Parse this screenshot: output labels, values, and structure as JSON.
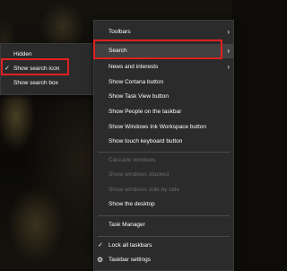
{
  "main_menu": {
    "items": [
      {
        "label": "Toolbars",
        "has_submenu": true,
        "disabled": false
      },
      {
        "label": "Search",
        "has_submenu": true,
        "disabled": false
      },
      {
        "label": "News and interests",
        "has_submenu": true,
        "disabled": false
      },
      {
        "label": "Show Cortana button",
        "disabled": false
      },
      {
        "label": "Show Task View button",
        "disabled": false
      },
      {
        "label": "Show People on the taskbar",
        "disabled": false
      },
      {
        "label": "Show Windows Ink Workspace button",
        "disabled": false
      },
      {
        "label": "Show touch keyboard button",
        "disabled": false
      },
      {
        "label": "Cascade windows",
        "disabled": true
      },
      {
        "label": "Show windows stacked",
        "disabled": true
      },
      {
        "label": "Show windows side by side",
        "disabled": true
      },
      {
        "label": "Show the desktop",
        "disabled": false
      },
      {
        "label": "Task Manager",
        "disabled": false
      },
      {
        "label": "Lock all taskbars",
        "checked": true
      },
      {
        "label": "Taskbar settings",
        "icon": "gear-icon"
      }
    ]
  },
  "search_submenu": {
    "items": [
      {
        "label": "Hidden"
      },
      {
        "label": "Show search icon",
        "checked": true
      },
      {
        "label": "Show search box"
      }
    ]
  },
  "glyphs": {
    "arrow": "›",
    "check": "✓",
    "gear": "⚙"
  },
  "colors": {
    "menu_bg": "#2b2b2b",
    "highlight": "#414141",
    "disabled_text": "#6a6a6a",
    "annotation_red": "#e02020"
  }
}
